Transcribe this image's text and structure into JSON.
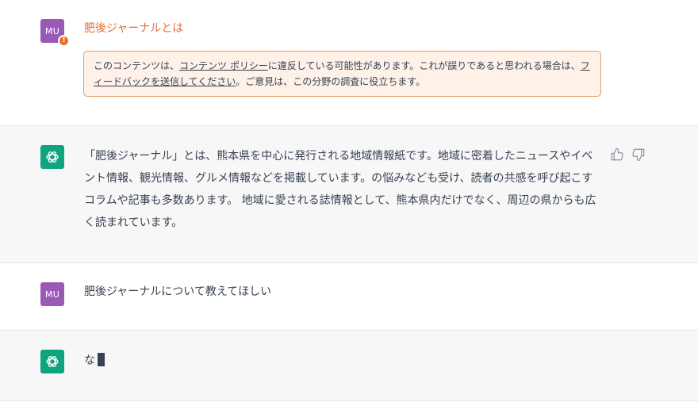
{
  "conversation": {
    "messages": [
      {
        "role": "user",
        "avatar_initials": "MU",
        "text": "肥後ジャーナルとは",
        "flagged": true,
        "warning_badge": "!",
        "notice": {
          "prefix": "このコンテンツは、",
          "policy_link": "コンテンツ ポリシー",
          "middle": "に違反している可能性があります。これが誤りであると思われる場合は、",
          "feedback_link": "フィードバックを送信してください",
          "suffix": "。ご意見は、この分野の調査に役立ちます。"
        }
      },
      {
        "role": "assistant",
        "text": "「肥後ジャーナル」とは、熊本県を中心に発行される地域情報紙です。地域に密着したニュースやイベント情報、観光情報、グルメ情報などを掲載しています。の悩みなども受け、読者の共感を呼び起こすコラムや記事も多数あります。 地域に愛される誌情報として、熊本県内だけでなく、周辺の県からも広く読まれています。"
      },
      {
        "role": "user",
        "avatar_initials": "MU",
        "text": "肥後ジャーナルについて教えてほしい"
      },
      {
        "role": "assistant",
        "text": "な",
        "streaming": true
      }
    ]
  },
  "icons": {
    "user_avatar": "avatar",
    "assistant_avatar": "openai-logo-icon",
    "thumbs_up": "thumbs-up-icon",
    "thumbs_down": "thumbs-down-icon",
    "warning": "warning-icon"
  },
  "colors": {
    "user_avatar": "#9b59b6",
    "assistant_avatar": "#10a37f",
    "flag_orange": "#e0703a",
    "notice_bg": "#fdf1e8",
    "notice_border": "#e69b66",
    "assistant_row_bg": "#f7f7f8"
  }
}
